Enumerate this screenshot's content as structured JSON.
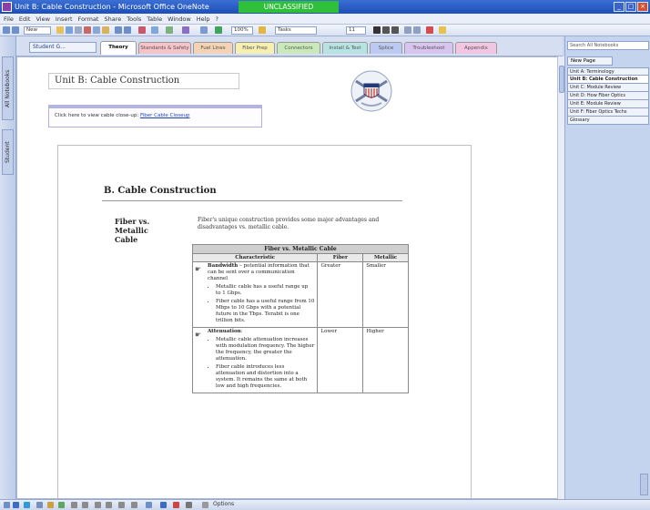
{
  "window": {
    "title": "Unit B: Cable Construction - Microsoft Office OneNote",
    "classification": "UNCLASSIFIED",
    "minimize": "_",
    "maximize": "□",
    "close": "×"
  },
  "menu": [
    "File",
    "Edit",
    "View",
    "Insert",
    "Format",
    "Share",
    "Tools",
    "Table",
    "Window",
    "Help",
    "?"
  ],
  "toolbar": {
    "new_label": "New",
    "zoom_value": "100%",
    "tags_label": "Tasks",
    "font_size": "11"
  },
  "left_nav": {
    "all_notebooks": "All Notebooks",
    "student": "Student"
  },
  "notebook": {
    "name": "Student G...",
    "sections": [
      "Theory",
      "Standards & Safety",
      "Fuel Lines",
      "Fiber Prep",
      "Connectors",
      "Install & Test",
      "Splice",
      "Troubleshoot",
      "Appendix"
    ],
    "active_section": "Theory"
  },
  "page": {
    "title": "Unit B: Cable Construction",
    "note_text": "Click here to view cable close-up:",
    "note_link": "Fiber Cable Closeup"
  },
  "content": {
    "heading": "B.   Cable Construction",
    "side_label": "Fiber vs. Metallic Cable",
    "intro": "Fiber's unique construction provides some major advantages and disadvantages vs. metallic cable.",
    "table": {
      "caption": "Fiber vs. Metallic Cable",
      "headers": [
        "Characteristic",
        "Fiber",
        "Metallic"
      ],
      "rows": [
        {
          "title": "Bandwidth",
          "desc": " – potential information that can be sent over a communication channel",
          "bullets": [
            "Metallic cable has a useful range up to 1 Gbps.",
            "Fiber cable has a useful range from 10 Mbps to 10 Gbps with a potential future in the Tbps. Terabit is one trillion bits."
          ],
          "fiber": "Greater",
          "metallic": "Smaller"
        },
        {
          "title": "Attenuation",
          "desc": ":",
          "bullets": [
            "Metallic cable attenuation increases with modulation frequency.  The higher the frequency, the greater the attenuation.",
            "Fiber cable introduces less attenuation and distortion into a system.  It remains the same at both low and high frequencies."
          ],
          "fiber": "Lower",
          "metallic": "Higher"
        }
      ]
    }
  },
  "right_panel": {
    "search_placeholder": "Search All Notebooks",
    "new_page": "New Page",
    "pages": [
      "Unit A: Terminology",
      "Unit B: Cable Construction",
      "Unit C: Module Review",
      "Unit D: How Fiber Optics",
      "Unit E: Module Review",
      "Unit F: Fiber Optics Techs",
      "Glossary"
    ],
    "selected_page_index": 1
  },
  "status_bar": {
    "options_label": "Options"
  },
  "colors": {
    "titlebar": "#1d4fb8",
    "classification_banner": "#2fbf3a",
    "panel": "#c4d3ee",
    "active_tab": "#ffffff"
  }
}
